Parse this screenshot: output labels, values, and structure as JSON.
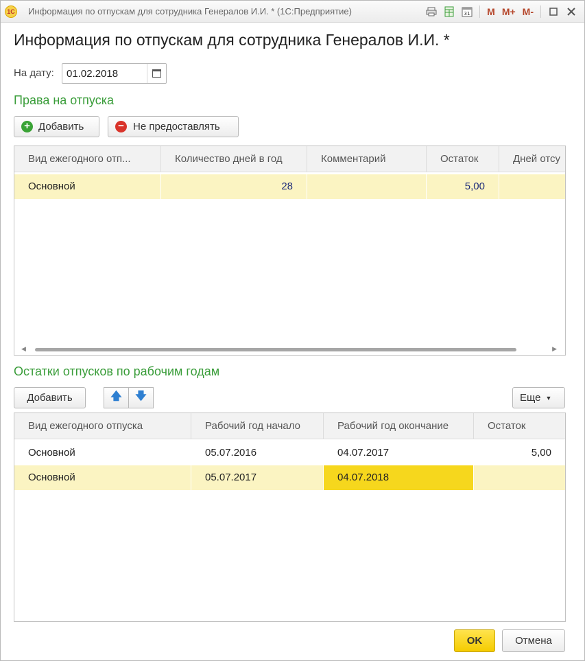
{
  "window": {
    "title": "Информация по отпускам для сотрудника Генералов И.И. * (1С:Предприятие)",
    "logo": "1С",
    "toolbar": {
      "m_label": "M",
      "mplus_label": "M+",
      "mminus_label": "M-"
    }
  },
  "form": {
    "title": "Информация по отпускам для сотрудника Генералов И.И. *",
    "date_label": "На дату:",
    "date_value": "01.02.2018"
  },
  "rights": {
    "section_title": "Права на отпуска",
    "add_label": "Добавить",
    "deny_label": "Не предоставлять",
    "columns": [
      "Вид ежегодного отп...",
      "Количество дней в год",
      "Комментарий",
      "Остаток",
      "Дней отсу"
    ],
    "rows": [
      {
        "type": "Основной",
        "days_per_year": "28",
        "comment": "",
        "remaining": "5,00",
        "days_abs": ""
      }
    ]
  },
  "balances": {
    "section_title": "Остатки отпусков по рабочим годам",
    "add_label": "Добавить",
    "more_label": "Еще",
    "columns": [
      "Вид ежегодного отпуска",
      "Рабочий год начало",
      "Рабочий год окончание",
      "Остаток"
    ],
    "rows": [
      {
        "type": "Основной",
        "start": "05.07.2016",
        "end": "04.07.2017",
        "remaining": "5,00"
      },
      {
        "type": "Основной",
        "start": "05.07.2017",
        "end": "04.07.2018",
        "remaining": ""
      }
    ]
  },
  "footer": {
    "ok_label": "OK",
    "cancel_label": "Отмена"
  },
  "colors": {
    "section_title": "#3a9d3a",
    "selected_row": "#fbf4c2",
    "active_cell": "#f6d71d",
    "ok_button": "#f5cc00"
  }
}
